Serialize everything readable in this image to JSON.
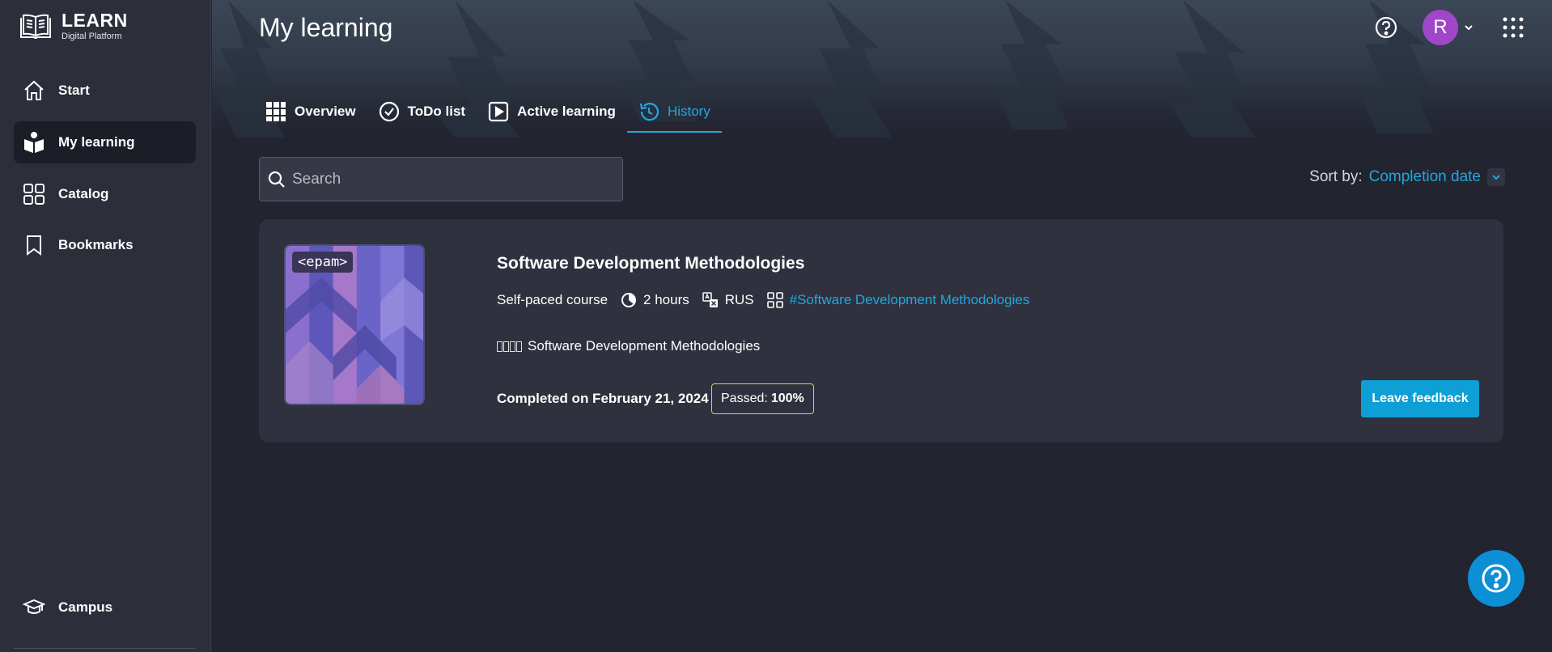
{
  "app": {
    "logo_title": "LEARN",
    "logo_subtitle": "Digital Platform"
  },
  "sidebar": {
    "items": [
      {
        "label": "Start",
        "icon": "home-icon"
      },
      {
        "label": "My learning",
        "icon": "learning-icon",
        "active": true
      },
      {
        "label": "Catalog",
        "icon": "catalog-icon"
      },
      {
        "label": "Bookmarks",
        "icon": "bookmark-icon"
      }
    ],
    "bottom_item": {
      "label": "Campus",
      "icon": "graduation-cap-icon"
    }
  },
  "header": {
    "title": "My learning",
    "avatar_initial": "R",
    "avatar_color": "#a046c9"
  },
  "tabs": [
    {
      "label": "Overview",
      "icon": "grid-icon"
    },
    {
      "label": "ToDo list",
      "icon": "check-circle-icon"
    },
    {
      "label": "Active learning",
      "icon": "play-square-icon"
    },
    {
      "label": "History",
      "icon": "history-icon",
      "active": true
    }
  ],
  "search": {
    "placeholder": "Search",
    "value": ""
  },
  "sort": {
    "label": "Sort by:",
    "value": "Completion date"
  },
  "course": {
    "thumbnail_badge": "<epam>",
    "title": "Software Development Methodologies",
    "type": "Self-paced course",
    "duration": "2 hours",
    "language": "RUS",
    "tag": "#Software Development Methodologies",
    "provider_label": "Software Development Methodologies",
    "completed": "Completed on February 21, 2024",
    "passed_label": "Passed:",
    "passed_value": "100%",
    "feedback_button": "Leave feedback"
  },
  "colors": {
    "accent": "#22a7e0",
    "button": "#0d9fd6",
    "passed_border": "#c9d66a"
  }
}
